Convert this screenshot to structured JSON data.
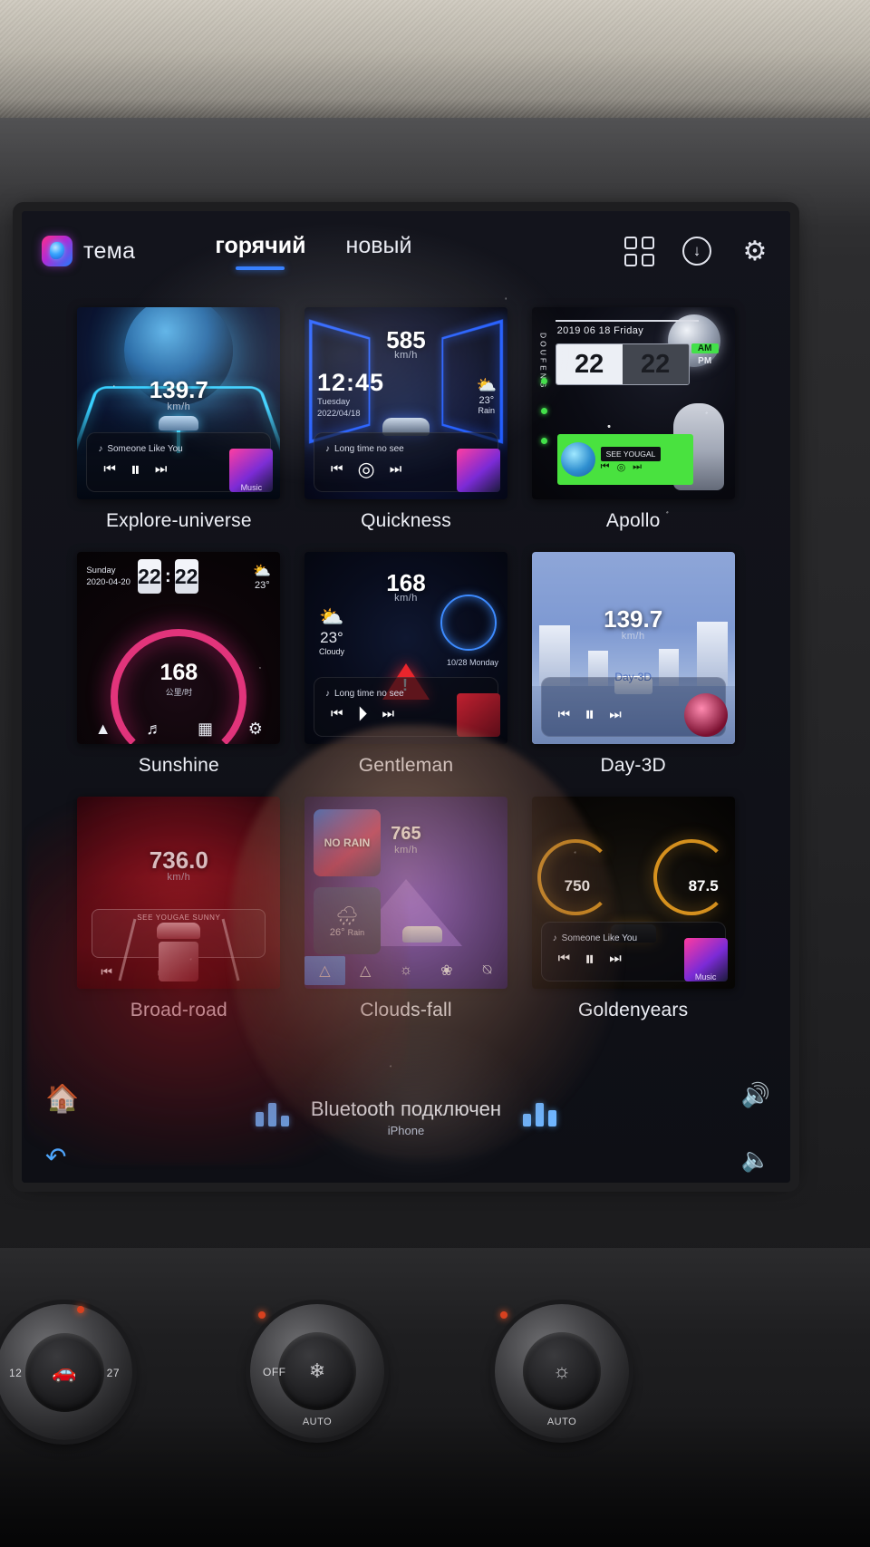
{
  "header": {
    "brand_label": "тема",
    "brand_icon": "theme-app-icon",
    "tabs": [
      {
        "label": "горячий",
        "active": true
      },
      {
        "label": "новый",
        "active": false
      }
    ],
    "actions": [
      {
        "name": "grid-view-icon",
        "glyph": ""
      },
      {
        "name": "download-icon",
        "glyph": "↓"
      },
      {
        "name": "gear-icon",
        "glyph": "⚙"
      }
    ]
  },
  "themes": [
    {
      "name": "Explore-universe",
      "speed": "139.7",
      "unit": "km/h",
      "song": "Someone Like You",
      "album_label": "Music"
    },
    {
      "name": "Quickness",
      "speed": "585",
      "unit": "km/h",
      "clock": "12:45",
      "weekday": "Tuesday",
      "date": "2022/04/18",
      "temp": "23°",
      "weather": "Rain",
      "song": "Long time no see"
    },
    {
      "name": "Apollo",
      "date_line": "2019 06 18  Friday",
      "hour": "22",
      "minute": "22",
      "am": "AM",
      "pm": "PM",
      "side_text": "DOUFENG",
      "banner": "SEE YOUGAL"
    },
    {
      "name": "Sunshine",
      "weekday": "Sunday",
      "date": "2020-04-20",
      "hour": "22",
      "minute": "22",
      "separator": ":",
      "temp": "23°",
      "speed": "168",
      "unit": "公里/时",
      "dock": [
        "navigation-icon",
        "music-icon",
        "apps-icon",
        "settings-icon"
      ]
    },
    {
      "name": "Gentleman",
      "speed": "168",
      "unit": "km/h",
      "temp": "23°",
      "weather": "Cloudy",
      "date": "10/28 Monday",
      "song": "Long time no see"
    },
    {
      "name": "Day-3D",
      "speed": "139.7",
      "unit": "km/h",
      "watermark": "Day-3D"
    },
    {
      "name": "Broad-road",
      "speed": "736.0",
      "unit": "km/h",
      "banner": "SEE YOUGAE SUNNY"
    },
    {
      "name": "Clouds-fall",
      "speed": "765",
      "unit": "km/h",
      "album_label": "NO RAIN",
      "temp": "26°",
      "weather": "Rain",
      "dock": [
        "navigation-icon",
        "warning-icon",
        "defrost-icon",
        "fan-icon",
        "compass-icon"
      ]
    },
    {
      "name": "Goldenyears",
      "left_value": "750",
      "right_value": "87.5",
      "song": "Someone Like You",
      "album_label": "Music"
    }
  ],
  "bottom_bar": {
    "home_icon": "home-icon",
    "back_icon": "back-arrow-icon",
    "status_title": "Bluetooth подключен",
    "device_name": "iPhone",
    "volume_up_icon": "volume-up-icon",
    "volume_down_icon": "volume-down-icon"
  },
  "dashboard": {
    "knobs": [
      {
        "name": "driver-temp-knob",
        "left": "12",
        "right": "27",
        "center": "seat-icon",
        "bottom": ""
      },
      {
        "name": "fan-mode-knob",
        "left": "OFF",
        "right": "",
        "center": "snowflake-icon",
        "bottom": "AUTO"
      },
      {
        "name": "passenger-temp-knob",
        "left": "",
        "right": "",
        "center": "defrost-icon",
        "bottom": "AUTO"
      }
    ]
  },
  "colors": {
    "accent": "#2f7bff",
    "screen_bg": "#11121a",
    "text": "#eceef6"
  }
}
